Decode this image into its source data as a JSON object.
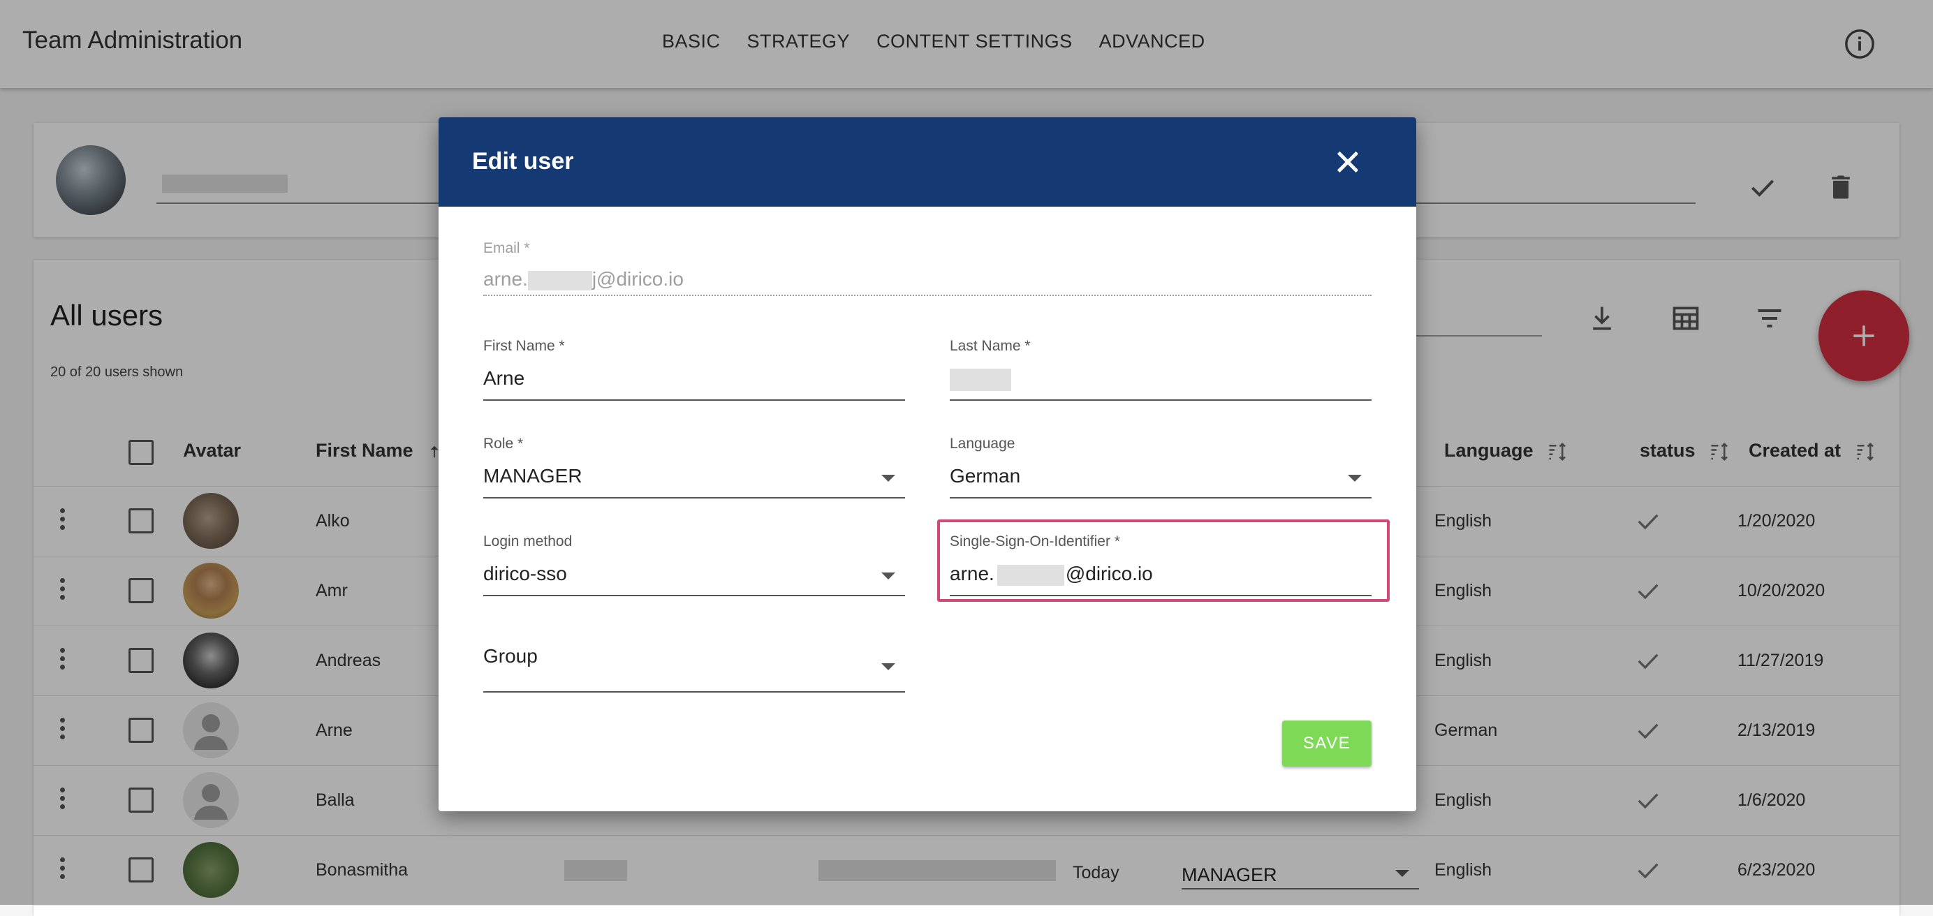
{
  "header": {
    "app_title": "Team Administration",
    "nav": [
      "BASIC",
      "STRATEGY",
      "CONTENT SETTINGS",
      "ADVANCED"
    ],
    "info_icon": "info-icon"
  },
  "profile": {
    "check_icon": "check-icon",
    "delete_icon": "trash-icon"
  },
  "users": {
    "title": "All users",
    "count_text": "20 of 20 users shown",
    "toolbar_icons": [
      "download-icon",
      "table-columns-icon",
      "filter-icon",
      "add-icon"
    ],
    "columns": {
      "avatar": "Avatar",
      "first_name": "First Name",
      "language": "Language",
      "status": "status",
      "created_at": "Created at"
    },
    "rows": [
      {
        "first_name": "Alko",
        "language": "English",
        "created": "1/20/2020"
      },
      {
        "first_name": "Amr",
        "language": "English",
        "created": "10/20/2020"
      },
      {
        "first_name": "Andreas",
        "language": "English",
        "created": "11/27/2019"
      },
      {
        "first_name": "Arne",
        "language": "German",
        "created": "2/13/2019"
      },
      {
        "first_name": "Balla",
        "language": "English",
        "created": "1/6/2020"
      },
      {
        "first_name": "Bonasmitha",
        "language": "English",
        "created": "6/23/2020",
        "last_active": "Today",
        "role": "MANAGER"
      }
    ]
  },
  "dialog": {
    "title": "Edit user",
    "email": {
      "label": "Email *",
      "value_prefix": "arne.",
      "value_suffix": "j@dirico.io"
    },
    "first_name": {
      "label": "First Name *",
      "value": "Arne"
    },
    "last_name": {
      "label": "Last Name *"
    },
    "role": {
      "label": "Role *",
      "value": "MANAGER"
    },
    "language": {
      "label": "Language",
      "value": "German"
    },
    "login_method": {
      "label": "Login method",
      "value": "dirico-sso"
    },
    "sso": {
      "label": "Single-Sign-On-Identifier *",
      "value_prefix": "arne.",
      "value_suffix": "@dirico.io"
    },
    "group": {
      "label": "Group"
    },
    "save_label": "SAVE",
    "accent_color": "#153972",
    "highlight_color": "#cf4a77",
    "save_color": "#7ed957"
  }
}
